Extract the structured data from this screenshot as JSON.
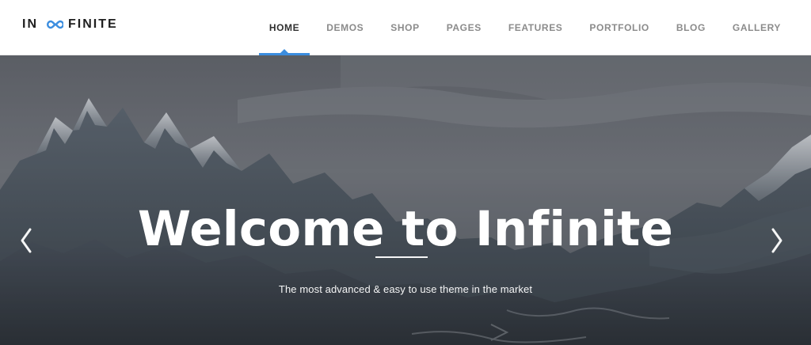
{
  "header": {
    "logo": {
      "left_text": "IN",
      "right_text": "FINITE",
      "mark_icon": "infinity-icon",
      "mark_color": "#3b8ddf"
    },
    "nav": {
      "active_index": 0,
      "items": [
        {
          "label": "HOME"
        },
        {
          "label": "DEMOS"
        },
        {
          "label": "SHOP"
        },
        {
          "label": "PAGES"
        },
        {
          "label": "FEATURES"
        },
        {
          "label": "PORTFOLIO"
        },
        {
          "label": "BLOG"
        },
        {
          "label": "GALLERY"
        }
      ],
      "active_color": "#3b8ddf"
    }
  },
  "hero": {
    "title": "Welcome to Infinite",
    "subtitle": "The most advanced & easy to use theme in the market",
    "prev_icon": "chevron-left-icon",
    "next_icon": "chevron-right-icon"
  }
}
